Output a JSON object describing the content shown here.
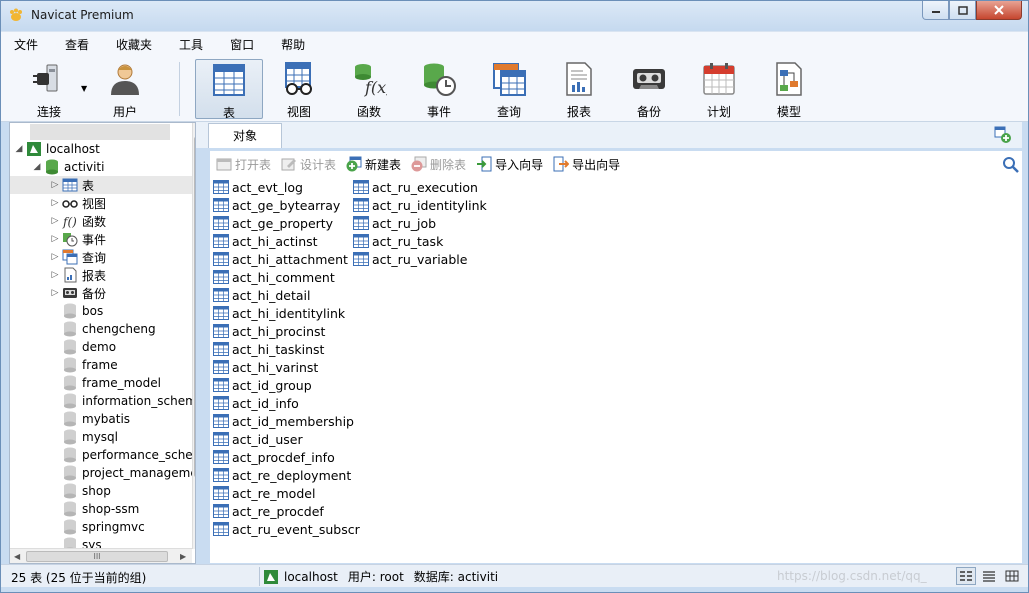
{
  "window": {
    "title": "Navicat Premium"
  },
  "menu": [
    "文件",
    "查看",
    "收藏夹",
    "工具",
    "窗口",
    "帮助"
  ],
  "toolbar": {
    "connect": "连接",
    "user": "用户",
    "table": "表",
    "view": "视图",
    "function": "函数",
    "event": "事件",
    "query": "查询",
    "report": "报表",
    "backup": "备份",
    "schedule": "计划",
    "model": "模型"
  },
  "tree": {
    "connection": "localhost",
    "active_db": "activiti",
    "categories": [
      "表",
      "视图",
      "函数",
      "事件",
      "查询",
      "报表",
      "备份"
    ],
    "databases": [
      "bos",
      "chengcheng",
      "demo",
      "frame",
      "frame_model",
      "information_schema",
      "mybatis",
      "mysql",
      "performance_schema",
      "project_management",
      "shop",
      "shop-ssm",
      "springmvc",
      "sys"
    ],
    "hscroll_grip": "III"
  },
  "tab": {
    "label": "对象"
  },
  "object_toolbar": {
    "open": "打开表",
    "design": "设计表",
    "new": "新建表",
    "delete": "删除表",
    "import": "导入向导",
    "export": "导出向导"
  },
  "tables_col1": [
    "act_evt_log",
    "act_ge_bytearray",
    "act_ge_property",
    "act_hi_actinst",
    "act_hi_attachment",
    "act_hi_comment",
    "act_hi_detail",
    "act_hi_identitylink",
    "act_hi_procinst",
    "act_hi_taskinst",
    "act_hi_varinst",
    "act_id_group",
    "act_id_info",
    "act_id_membership",
    "act_id_user",
    "act_procdef_info",
    "act_re_deployment",
    "act_re_model",
    "act_re_procdef",
    "act_ru_event_subscr"
  ],
  "tables_col2": [
    "act_ru_execution",
    "act_ru_identitylink",
    "act_ru_job",
    "act_ru_task",
    "act_ru_variable"
  ],
  "status": {
    "count": "25 表 (25 位于当前的组)",
    "connection": "localhost",
    "user": "用户: root",
    "database": "数据库: activiti",
    "watermark": "https://blog.csdn.net/qq_"
  },
  "colors": {
    "table_icon": "#3b6fb6",
    "db_icon": "#4aa34a",
    "title_bg": "#c5d9ef"
  }
}
